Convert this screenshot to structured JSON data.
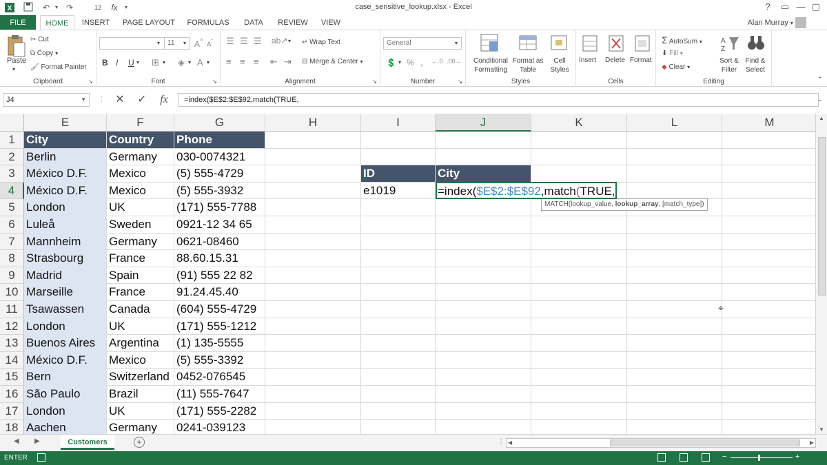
{
  "window": {
    "title": "case_sensitive_lookup.xlsx - Excel",
    "help_label": "?",
    "minimize_label": "—",
    "restore_label": "▢",
    "close_label": "✕"
  },
  "quick_access": {
    "save_icon": "save-icon",
    "undo_icon": "undo-icon",
    "redo_icon": "redo-icon"
  },
  "ribbon": {
    "file_tab": "FILE",
    "tabs": [
      "HOME",
      "INSERT",
      "PAGE LAYOUT",
      "FORMULAS",
      "DATA",
      "REVIEW",
      "VIEW"
    ],
    "active_tab": "HOME",
    "user": "Alan Murray",
    "groups": {
      "clipboard": {
        "label": "Clipboard",
        "paste": "Paste",
        "cut": "Cut",
        "copy": "Copy",
        "format_painter": "Format Painter"
      },
      "font": {
        "label": "Font",
        "font_name": "",
        "font_size": "11",
        "bold": "B",
        "italic": "I",
        "underline": "U"
      },
      "alignment": {
        "label": "Alignment",
        "wrap_text": "Wrap Text",
        "merge_center": "Merge & Center"
      },
      "number": {
        "label": "Number",
        "format": "General",
        "percent": "%",
        "comma": ","
      },
      "styles": {
        "label": "Styles",
        "conditional": "Conditional Formatting",
        "format_table": "Format as Table",
        "cell_styles": "Cell Styles"
      },
      "cells": {
        "label": "Cells",
        "insert": "Insert",
        "delete": "Delete",
        "format": "Format"
      },
      "editing": {
        "label": "Editing",
        "autosum": "AutoSum",
        "fill": "Fill",
        "clear": "Clear",
        "sort_filter": "Sort & Filter",
        "find_select": "Find & Select"
      }
    }
  },
  "formula_bar": {
    "name_box": "J4",
    "cancel": "✕",
    "enter": "✓",
    "fx": "fx",
    "formula": "=index($E$2:$E$92,match(TRUE,"
  },
  "grid": {
    "columns": [
      "E",
      "F",
      "G",
      "H",
      "I",
      "J",
      "K",
      "L",
      "M"
    ],
    "selected_column": "J",
    "rows": [
      "1",
      "2",
      "3",
      "4",
      "5",
      "6",
      "7",
      "8",
      "9",
      "10",
      "11",
      "12",
      "13",
      "14",
      "15",
      "16",
      "17",
      "18"
    ],
    "selected_row": "4",
    "table_headers": [
      "City",
      "Country",
      "Phone"
    ],
    "table_rows": [
      [
        "Berlin",
        "Germany",
        "030-0074321"
      ],
      [
        "México D.F.",
        "Mexico",
        "(5) 555-4729"
      ],
      [
        "México D.F.",
        "Mexico",
        "(5) 555-3932"
      ],
      [
        "London",
        "UK",
        "(171) 555-7788"
      ],
      [
        "Luleå",
        "Sweden",
        "0921-12 34 65"
      ],
      [
        "Mannheim",
        "Germany",
        "0621-08460"
      ],
      [
        "Strasbourg",
        "France",
        "88.60.15.31"
      ],
      [
        "Madrid",
        "Spain",
        "(91) 555 22 82"
      ],
      [
        "Marseille",
        "France",
        "91.24.45.40"
      ],
      [
        "Tsawassen",
        "Canada",
        "(604) 555-4729"
      ],
      [
        "London",
        "UK",
        "(171) 555-1212"
      ],
      [
        "Buenos Aires",
        "Argentina",
        "(1) 135-5555"
      ],
      [
        "México D.F.",
        "Mexico",
        "(5) 555-3392"
      ],
      [
        "Bern",
        "Switzerland",
        "0452-076545"
      ],
      [
        "São Paulo",
        "Brazil",
        "(11) 555-7647"
      ],
      [
        "London",
        "UK",
        "(171) 555-2282"
      ],
      [
        "Aachen",
        "Germany",
        "0241-039123"
      ]
    ],
    "lookup_headers": [
      "ID",
      "City"
    ],
    "lookup_id": "e1019",
    "edit_prefix": "=index(",
    "edit_range": "$E$2:$E$92",
    "edit_mid": ",match",
    "edit_paren": "(",
    "edit_suffix": "TRUE,",
    "tooltip_pre": "MATCH(lookup_value, ",
    "tooltip_bold": "lookup_array",
    "tooltip_post": ", [match_type])"
  },
  "sheets": {
    "active": "Customers",
    "add_label": "+"
  },
  "status": {
    "mode": "ENTER"
  },
  "colors": {
    "excel_green": "#217346",
    "table_header": "#44546a",
    "range_blue": "#4a86c8",
    "paren_red": "#c0504d"
  }
}
